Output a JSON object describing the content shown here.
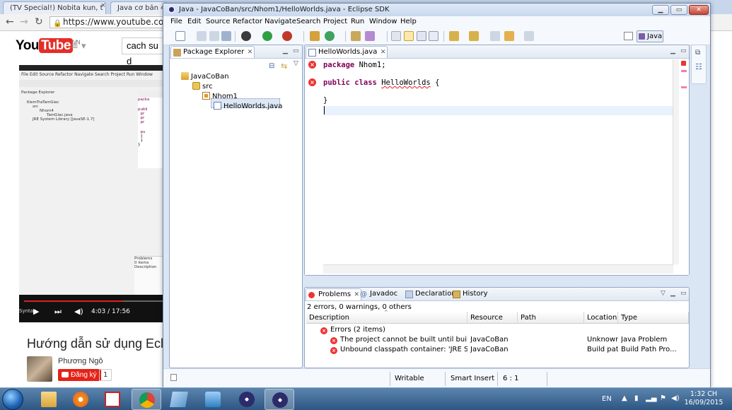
{
  "browser": {
    "tabs": [
      {
        "title": "(TV Special!) Nobita kun, t"
      },
      {
        "title": "Java cơ bản 4"
      }
    ],
    "url": "https://www.youtube.com",
    "yt_logo_you": "You",
    "yt_logo_tube": "Tube",
    "yt_region": "VN",
    "search_value": "cach su d",
    "video": {
      "time": "4:03 / 17:56",
      "title": "Hướng dẫn sử dụng Ecli",
      "author": "Phương Ngô",
      "subscribe_label": "Đăng ký",
      "subscriber_count": "1",
      "thumb_menu": "File  Edit  Source  Refactor  Navigate  Search  Project  Run  Window",
      "thumb_tree": [
        "KiemTraTamGiac",
        "src",
        "Nhom4",
        "TamGiac.java",
        "JRE System Library [JavaSE-1.7]"
      ],
      "thumb_pe_tab": "Package Explorer",
      "thumb_prob_tab": "Problems",
      "thumb_prob_items": "0 items",
      "thumb_prob_desc": "Description",
      "thumb_sub": "Syntax"
    }
  },
  "eclipse": {
    "title": "Java - JavaCoBan/src/Nhom1/HelloWorlds.java - Eclipse SDK",
    "menu": [
      "File",
      "Edit",
      "Source",
      "Refactor",
      "Navigate",
      "Search",
      "Project",
      "Run",
      "Window",
      "Help"
    ],
    "perspective": "Java",
    "package_explorer": {
      "tab": "Package Explorer",
      "tree": [
        {
          "label": "JavaCoBan",
          "icon": "project-icon"
        },
        {
          "label": "src",
          "icon": "source-folder-icon"
        },
        {
          "label": "Nhom1",
          "icon": "package-icon"
        },
        {
          "label": "HelloWorlds.java",
          "icon": "java-file-icon"
        }
      ]
    },
    "editor": {
      "tab": "HelloWorlds.java",
      "code": {
        "line1_kw": "package",
        "line1_rest": " Nhom1;",
        "line3_kw1": "public",
        "line3_kw2": "class",
        "line3_name": "HelloWorlds",
        "line3_rest": " {",
        "line5": "}"
      }
    },
    "bottom_tabs": [
      "Problems",
      "Javadoc",
      "Declaration",
      "History"
    ],
    "problems": {
      "summary": "2 errors, 0 warnings, 0 others",
      "columns": [
        "Description",
        "Resource",
        "Path",
        "Location",
        "Type"
      ],
      "group": "Errors (2 items)",
      "rows": [
        {
          "description": "The project cannot be built until build path e",
          "resource": "JavaCoBan",
          "path": "",
          "location": "Unknown",
          "type": "Java Problem"
        },
        {
          "description": "Unbound classpath container: 'JRE System Lil",
          "resource": "JavaCoBan",
          "path": "",
          "location": "Build path",
          "type": "Build Path Pro..."
        }
      ]
    },
    "status": {
      "writable": "Writable",
      "insert_mode": "Smart Insert",
      "position": "6 : 1"
    }
  },
  "taskbar": {
    "language": "EN",
    "time": "1:32 CH",
    "date": "16/09/2015"
  },
  "colors": {
    "keyword": "#7f0055",
    "error": "#e33333",
    "youtube_red": "#e52d27",
    "taskbar": "#2d5683"
  }
}
